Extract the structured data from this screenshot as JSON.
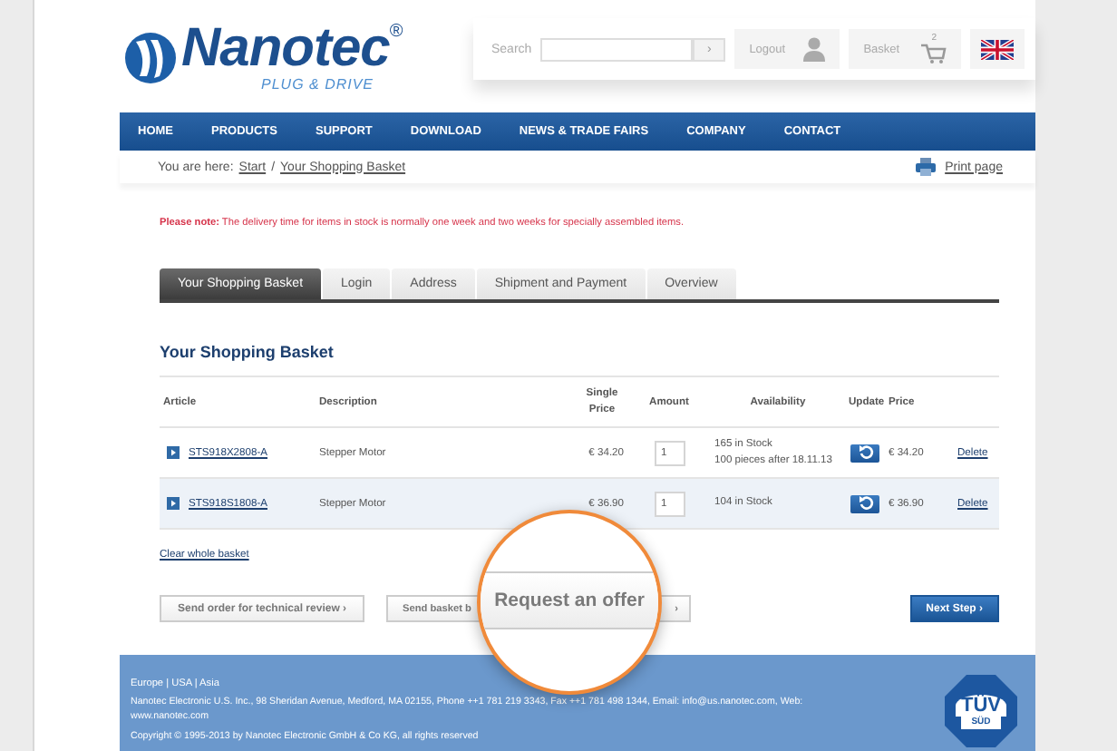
{
  "header": {
    "logo": {
      "name": "Nanotec",
      "mark": "®",
      "tagline": "PLUG & DRIVE"
    },
    "search": {
      "label": "Search",
      "button": "›"
    },
    "logout": "Logout",
    "basket": {
      "label": "Basket",
      "count": "2"
    }
  },
  "nav": [
    "HOME",
    "PRODUCTS",
    "SUPPORT",
    "DOWNLOAD",
    "NEWS & TRADE FAIRS",
    "COMPANY",
    "CONTACT"
  ],
  "breadcrumb": {
    "prefix": "You are here:",
    "links": [
      "Start",
      "Your Shopping Basket"
    ],
    "separator": "/",
    "print": "Print page"
  },
  "note": "**Please note:** The delivery time for items in stock is normally one week and two weeks for specially assembled items.",
  "tabs": [
    {
      "label": "Your Shopping Basket",
      "selected": true
    },
    {
      "label": "Login",
      "selected": false
    },
    {
      "label": "Address",
      "selected": false
    },
    {
      "label": "Shipment and Payment",
      "selected": false
    },
    {
      "label": "Overview",
      "selected": false
    }
  ],
  "heading": "Your Shopping Basket",
  "table": {
    "columns": [
      "Article",
      "Description",
      "Single Price",
      "Amount",
      "Availability",
      "Update",
      "Price"
    ],
    "rows": [
      {
        "article": "STS918X2808-A",
        "description": "Stepper Motor",
        "single_price": "€ 34.20",
        "amount": "1",
        "availability": [
          "165 in Stock",
          "100 pieces after 18.11.13"
        ],
        "price": "€ 34.20",
        "delete": "Delete",
        "highlighted": false
      },
      {
        "article": "STS918S1808-A",
        "description": "Stepper Motor",
        "single_price": "€ 36.90",
        "amount": "1",
        "availability": [
          "104 in Stock"
        ],
        "price": "€ 36.90",
        "delete": "Delete",
        "highlighted": true
      }
    ]
  },
  "clear": "Clear whole basket",
  "buttons": [
    {
      "kind": "secondary",
      "label": "Send order for technical review ›"
    },
    {
      "kind": "covered",
      "label": "Send basket b",
      "tail": "›"
    },
    {
      "kind": "primary",
      "label": "Next Step ›"
    }
  ],
  "magnifier": {
    "label": "Request an offer"
  },
  "footer": {
    "regions": "Europe | USA | Asia",
    "address": "Nanotec Electronic U.S. Inc., 98 Sheridan Avenue, Medford, MA 02155, Phone ++1 781 219 3343, Fax ++1 781 498 1344, Email: info@us.nanotec.com, Web: www.nanotec.com",
    "copyright": "Copyright © 1995-2013 by Nanotec Electronic GmbH & Co KG, all rights reserved",
    "badge": {
      "top": "TÜV",
      "bottom": "SÜD"
    }
  }
}
